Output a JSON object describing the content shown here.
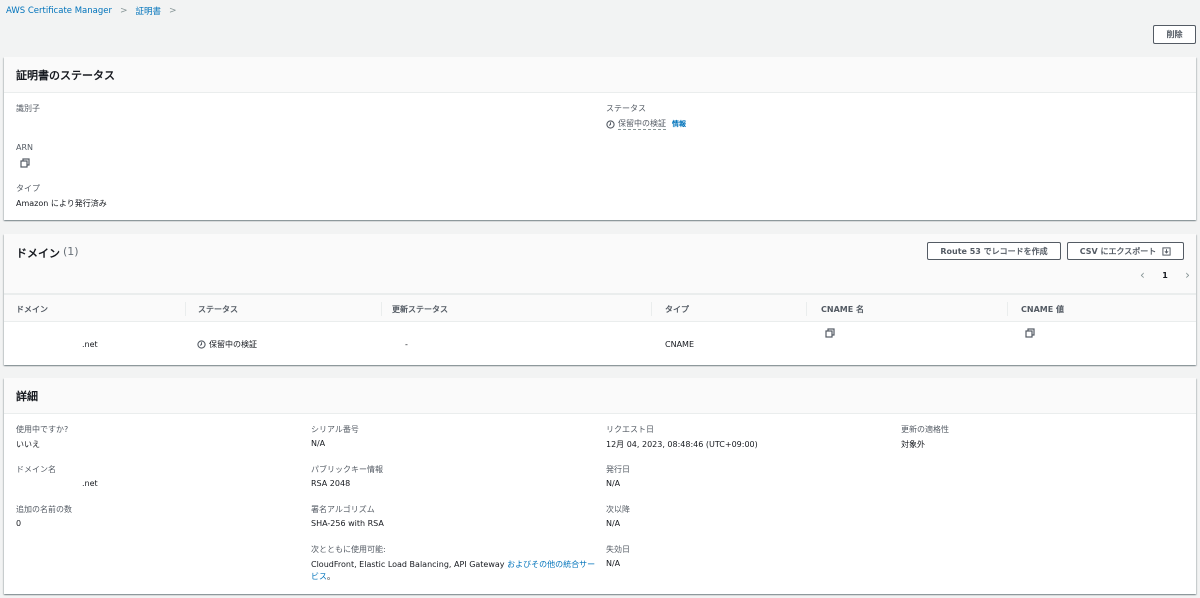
{
  "breadcrumb": [
    "AWS Certificate Manager",
    "証明書"
  ],
  "delete_button": "削除",
  "status_card": {
    "title": "証明書のステータス",
    "identifier_label": "識別子",
    "arn_label": "ARN",
    "type_label": "タイプ",
    "type_value": "Amazon により発行済み",
    "status_label": "ステータス",
    "status_value": "保留中の検証",
    "info_link": "情報"
  },
  "domain_card": {
    "title": "ドメイン",
    "count": "(1)",
    "route53_button": "Route 53 でレコードを作成",
    "csv_button": "CSV にエクスポート",
    "page": "1",
    "columns": [
      "ドメイン",
      "ステータス",
      "更新ステータス",
      "タイプ",
      "CNAME 名",
      "CNAME 値"
    ],
    "rows": [
      {
        "domain": ".net",
        "status": "保留中の検証",
        "renewal": "-",
        "type": "CNAME"
      }
    ]
  },
  "details_card": {
    "title": "詳細",
    "in_use_label": "使用中ですか?",
    "in_use_value": "いいえ",
    "domain_name_label": "ドメイン名",
    "domain_name_value": ".net",
    "additional_names_label": "追加の名前の数",
    "additional_names_value": "0",
    "serial_label": "シリアル番号",
    "serial_value": "N/A",
    "public_key_label": "パブリックキー情報",
    "public_key_value": "RSA 2048",
    "signature_label": "署名アルゴリズム",
    "signature_value": "SHA-256 with RSA",
    "usable_with_label": "次とともに使用可能:",
    "usable_with_value": "CloudFront, Elastic Load Balancing, API Gateway ",
    "usable_with_link_1": "およびその他の統合サー",
    "usable_with_link_2": "ビス",
    "usable_with_end": "。",
    "requested_label": "リクエスト日",
    "requested_value": "12月 04, 2023, 08:48:46 (UTC+09:00)",
    "issued_label": "発行日",
    "issued_value": "N/A",
    "not_before_label": "次以降",
    "not_before_value": "N/A",
    "not_after_label": "失効日",
    "not_after_value": "N/A",
    "renewal_label": "更新の適格性",
    "renewal_value": "対象外"
  }
}
